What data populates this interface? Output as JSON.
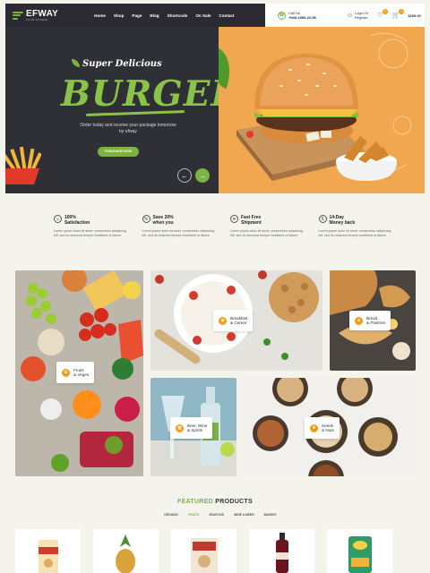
{
  "header": {
    "logo": {
      "name": "EFWAY",
      "tagline": "FOOD STORES"
    },
    "nav": [
      "Home",
      "Shop",
      "Page",
      "Blog",
      "Shortcode",
      "On Sale",
      "Contact"
    ],
    "call": {
      "label": "Call Us",
      "number": "+049-1900-22-96"
    },
    "login": {
      "line1": "Login Or",
      "line2": "Register"
    },
    "wishlist_count": "0",
    "cart_count": "0",
    "cart_total": "$259.00"
  },
  "hero": {
    "eyebrow": "Super Delicious",
    "title": "BURGER",
    "description": "Order today and receive your package tomorrow by efway",
    "button": "PURCHASE NOW",
    "prev_icon": "←",
    "next_icon": "→"
  },
  "features": [
    {
      "icon": "smile-icon",
      "glyph": "☺",
      "title1": "100%",
      "title2": "Satisfaction",
      "text": "Lorem ipsum dolor sit amet, consectetur adipiscing elit, sed do eiusmod tempor incididunt ut labore"
    },
    {
      "icon": "discount-icon",
      "glyph": "%",
      "title1": "Save 20%",
      "title2": "when you",
      "text": "Lorem ipsum dolor sit amet, consectetur adipiscing elit, sed do eiusmod tempor incididunt ut labore"
    },
    {
      "icon": "shipment-icon",
      "glyph": "➤",
      "title1": "Fast Free",
      "title2": "Shipment",
      "text": "Lorem ipsum dolor sit amet, consectetur adipiscing elit, sed do eiusmod tempor incididunt ut labore"
    },
    {
      "icon": "money-back-icon",
      "glyph": "$",
      "title1": "14-Day",
      "title2": "Money back",
      "text": "Lorem ipsum dolor sit amet, consectetur adipiscing elit, sed do eiusmod tempor incididunt ut labore"
    }
  ],
  "categories": [
    {
      "line1": "Fruits",
      "line2": "& Veges"
    },
    {
      "line1": "Breakfast",
      "line2": "& Cereal"
    },
    {
      "line1": "Bread",
      "line2": "& Pastries"
    },
    {
      "line1": "Beer, Wine",
      "line2": "& Spirits"
    },
    {
      "line1": "Seeds",
      "line2": "& Nuts"
    }
  ],
  "featured": {
    "title_green": "FEATURED",
    "title_dark": " PRODUCTS",
    "tabs": [
      "ORGANIC",
      "FRUITS",
      "SEAFOOD",
      "WINE & BEER",
      "BAKERY"
    ],
    "active_tab": 1
  },
  "colors": {
    "accent": "#7cb342",
    "dark": "#2f2f36",
    "orange": "#f0a74f"
  }
}
